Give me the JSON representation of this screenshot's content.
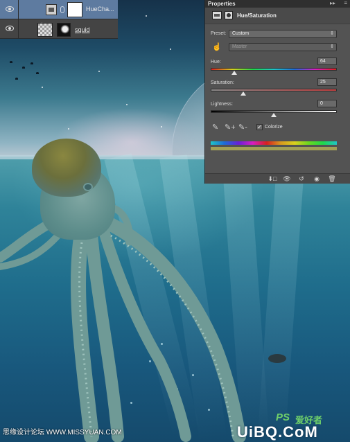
{
  "layers_panel": {
    "layers": [
      {
        "name": "HueCha...",
        "type": "adjustment",
        "selected": true
      },
      {
        "name": "squid",
        "type": "image",
        "selected": false
      }
    ]
  },
  "properties_panel": {
    "tab_label": "Properties",
    "collapse_glyph": "▸▸",
    "menu_glyph": "≡",
    "title": "Hue/Saturation",
    "preset": {
      "label": "Preset:",
      "value": "Custom"
    },
    "channel": {
      "value": "Master"
    },
    "hue": {
      "label": "Hue:",
      "value": "64"
    },
    "saturation": {
      "label": "Saturation:",
      "value": "25"
    },
    "lightness": {
      "label": "Lightness:",
      "value": "0"
    },
    "colorize": {
      "label": "Colorize",
      "checked": true,
      "check_glyph": "✓"
    },
    "result_color": "#a2a055"
  },
  "watermarks": {
    "left_text": "思缘设计论坛 WWW.MISSYUAN.COM",
    "ps_text": "PS",
    "cn_text": "爱好者",
    "right_text": "UiBQ.CoM"
  },
  "icons": {
    "hand": "☝",
    "eyedropper": "✎",
    "eyedropper_plus": "✎+",
    "eyedropper_minus": "✎-",
    "clip": "⬇□",
    "view_prev": "👁",
    "reset": "↺",
    "visibility": "◉",
    "trash": "🗑"
  }
}
